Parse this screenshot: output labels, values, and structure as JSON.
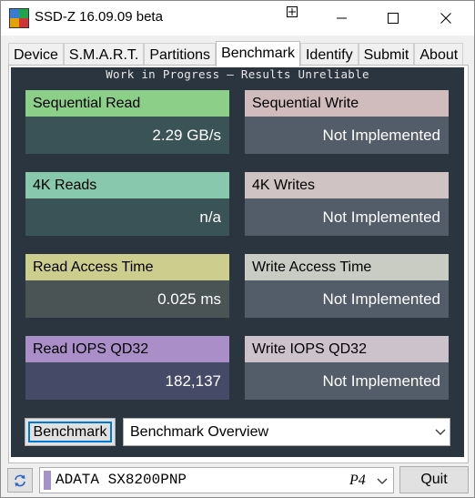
{
  "window": {
    "title": "SSD-Z 16.09.09 beta",
    "controls": {
      "minimize": "minimize",
      "maximize": "maximize",
      "close": "close"
    }
  },
  "tabs": [
    {
      "label": "Device"
    },
    {
      "label": "S.M.A.R.T."
    },
    {
      "label": "Partitions"
    },
    {
      "label": "Benchmark",
      "active": true
    },
    {
      "label": "Identify"
    },
    {
      "label": "Submit"
    },
    {
      "label": "About"
    }
  ],
  "benchmark": {
    "notice": "Work in Progress – Results Unreliable",
    "cards": [
      {
        "title": "Sequential Read",
        "value": "2.29 GB/s"
      },
      {
        "title": "Sequential Write",
        "value": "Not Implemented"
      },
      {
        "title": "4K Reads",
        "value": "n/a"
      },
      {
        "title": "4K Writes",
        "value": "Not Implemented"
      },
      {
        "title": "Read Access Time",
        "value": "0.025 ms"
      },
      {
        "title": "Write Access Time",
        "value": "Not Implemented"
      },
      {
        "title": "Read IOPS QD32",
        "value": "182,137"
      },
      {
        "title": "Write IOPS QD32",
        "value": "Not Implemented"
      }
    ],
    "run_button": "Benchmark",
    "mode_select": "Benchmark Overview"
  },
  "footer": {
    "drive_name": "ADATA SX8200PNP",
    "drive_index": "P4",
    "quit_button": "Quit"
  },
  "colors": {
    "panel_background": "#2b3540",
    "read_iops_accent": "#a592c8",
    "focus_ring": "#0078d7"
  },
  "icons": [
    "app-icon",
    "pin-icon",
    "minimize-icon",
    "maximize-icon",
    "close-icon",
    "chevron-down-icon",
    "refresh-icon"
  ]
}
